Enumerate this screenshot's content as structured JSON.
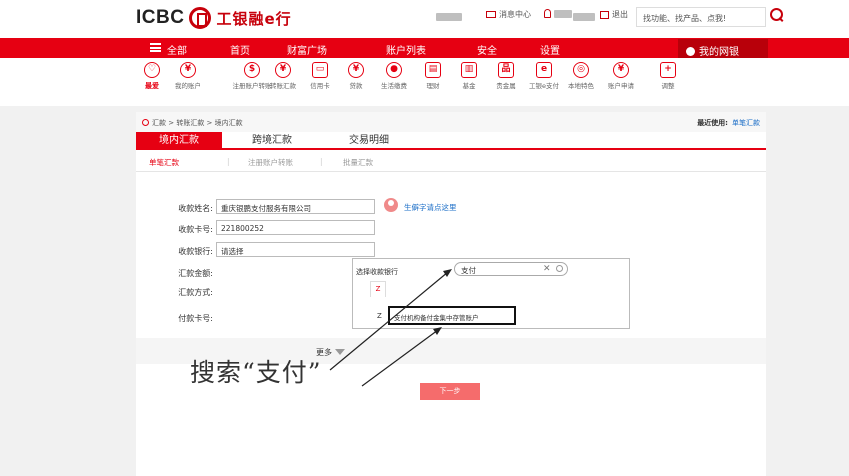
{
  "header": {
    "logo_text": "ICBC",
    "logo_cn": "工银融e行",
    "message_center": "消息中心",
    "logout": "退出",
    "search_placeholder": "找功能、找产品、点我!"
  },
  "nav": {
    "all": "全部",
    "items": [
      "首页",
      "财富广场",
      "账户列表",
      "安全",
      "设置"
    ],
    "my_bank": "我的网银"
  },
  "shortcuts": [
    {
      "label": "最爱",
      "icon": "heart-icon"
    },
    {
      "label": "我的账户",
      "icon": "yuan-circle-icon"
    },
    {
      "label": "注册账户转账",
      "icon": "bag-icon"
    },
    {
      "label": "转账汇款",
      "icon": "transfer-icon"
    },
    {
      "label": "信用卡",
      "icon": "card-icon"
    },
    {
      "label": "贷款",
      "icon": "loan-icon"
    },
    {
      "label": "生活缴费",
      "icon": "drop-icon"
    },
    {
      "label": "理财",
      "icon": "wealth-icon"
    },
    {
      "label": "基金",
      "icon": "fund-icon"
    },
    {
      "label": "贵金属",
      "icon": "gold-icon"
    },
    {
      "label": "工银e支付",
      "icon": "epay-icon"
    },
    {
      "label": "本地特色",
      "icon": "local-icon"
    },
    {
      "label": "账户申请",
      "icon": "apply-icon"
    },
    {
      "label": "调整",
      "icon": "plus-icon"
    }
  ],
  "breadcrumb": "汇款 > 转账汇款 > 境内汇款",
  "recent": {
    "label": "最近使用:",
    "link": "单笔汇款"
  },
  "tabs": [
    "境内汇款",
    "跨境汇款",
    "交易明细"
  ],
  "subtabs": [
    "单笔汇款",
    "注册账户转账",
    "批量汇款"
  ],
  "form": {
    "payee_name_label": "收款姓名:",
    "payee_name_value": "重庆银鹏支付服务有限公司",
    "beneficiary_link": "生僻字请点这里",
    "account_label": "收款卡号:",
    "account_value": "221800252",
    "bank_label": "收款银行:",
    "bank_value": "请选择",
    "amount_label": "汇款金额:",
    "method_label": "汇款方式:",
    "pay_card_label": "付款卡号:"
  },
  "dropdown": {
    "hint": "选择收款银行",
    "search_value": "支付",
    "letter_tab": "Z",
    "option_letter": "Z",
    "option_text": "支付机构备付金集中存管账户"
  },
  "more_label": "更多",
  "next_button": "下一步",
  "annotation": "搜索“支付”",
  "colors": {
    "brand_red": "#e60012",
    "dark_red": "#b8000a",
    "link_blue": "#1a6dc7"
  }
}
